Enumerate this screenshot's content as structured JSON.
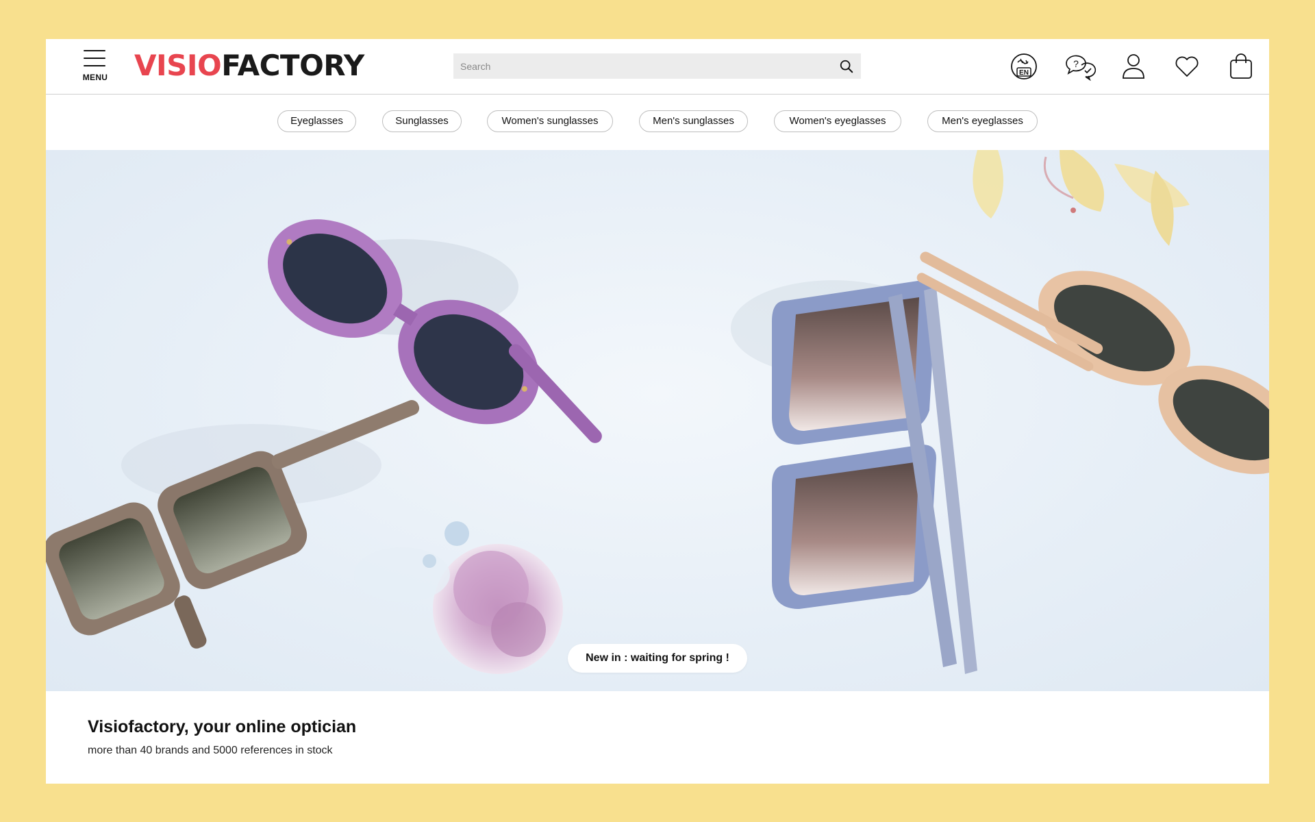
{
  "header": {
    "menu_label": "MENU",
    "logo_part1": "VISIO",
    "logo_part2": "FACTORY",
    "search_placeholder": "Search",
    "language_badge": "EN",
    "icons": [
      "language-icon",
      "help-chat-icon",
      "account-icon",
      "wishlist-heart-icon",
      "shopping-bag-icon"
    ]
  },
  "categories": [
    "Eyeglasses",
    "Sunglasses",
    "Women's sunglasses",
    "Men's sunglasses",
    "Women's eyeglasses",
    "Men's eyeglasses"
  ],
  "hero": {
    "cta_label": "New in : waiting for spring !"
  },
  "intro": {
    "title": "Visiofactory, your online optician",
    "subtitle": "more than 40 brands and 5000 references in stock"
  },
  "colors": {
    "background": "#f8e08e",
    "brand_red": "#e8454f",
    "text": "#111111"
  }
}
